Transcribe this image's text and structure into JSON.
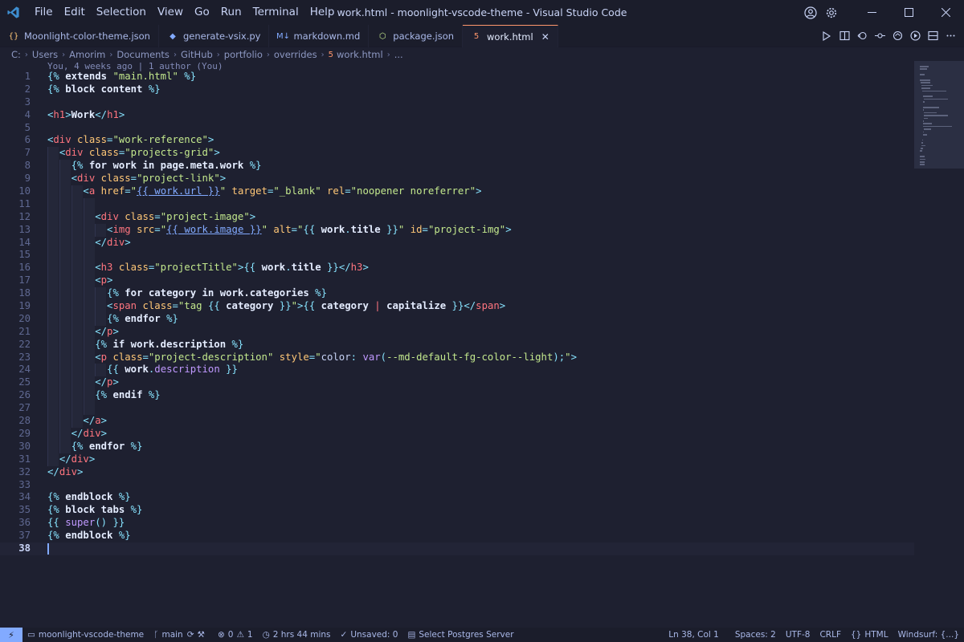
{
  "window": {
    "title": "work.html - moonlight-vscode-theme - Visual Studio Code",
    "menu": [
      "File",
      "Edit",
      "Selection",
      "View",
      "Go",
      "Run",
      "Terminal",
      "Help"
    ]
  },
  "tabs": [
    {
      "label": "Moonlight-color-theme.json",
      "icon": "json-icon",
      "glyph": "{}",
      "color": "#ffc777",
      "active": false
    },
    {
      "label": "generate-vsix.py",
      "icon": "python-icon",
      "glyph": "◆",
      "color": "#82aaff",
      "active": false
    },
    {
      "label": "markdown.md",
      "icon": "markdown-icon",
      "glyph": "M↓",
      "color": "#82aaff",
      "active": false
    },
    {
      "label": "package.json",
      "icon": "nodejs-icon",
      "glyph": "⬡",
      "color": "#c3e88d",
      "active": false
    },
    {
      "label": "work.html",
      "icon": "html-icon",
      "glyph": "5",
      "color": "#ff966c",
      "active": true
    }
  ],
  "breadcrumb": [
    "C:",
    "Users",
    "Amorim",
    "Documents",
    "GitHub",
    "portfolio",
    "overrides",
    "work.html",
    "..."
  ],
  "blame": "You, 4 weeks ago | 1 author (You)",
  "current_line": 38,
  "code_lines": [
    {
      "n": 1,
      "indent": 0,
      "tokens": [
        [
          "punct",
          "{%"
        ],
        [
          "text",
          " extends "
        ],
        [
          "str",
          "\"main.html\""
        ],
        [
          "punct",
          " %}"
        ]
      ]
    },
    {
      "n": 2,
      "indent": 0,
      "tokens": [
        [
          "punct",
          "{%"
        ],
        [
          "text",
          " block content "
        ],
        [
          "punct",
          "%}"
        ]
      ]
    },
    {
      "n": 3,
      "indent": 0,
      "tokens": []
    },
    {
      "n": 4,
      "indent": 0,
      "tokens": [
        [
          "punct",
          "<"
        ],
        [
          "tag",
          "h1"
        ],
        [
          "punct",
          ">"
        ],
        [
          "text",
          "Work"
        ],
        [
          "punct",
          "</"
        ],
        [
          "tag",
          "h1"
        ],
        [
          "punct",
          ">"
        ]
      ]
    },
    {
      "n": 5,
      "indent": 0,
      "tokens": []
    },
    {
      "n": 6,
      "indent": 0,
      "tokens": [
        [
          "punct",
          "<"
        ],
        [
          "tag",
          "div"
        ],
        [
          "attr",
          " class"
        ],
        [
          "punct",
          "="
        ],
        [
          "str",
          "\"work-reference\""
        ],
        [
          "punct",
          ">"
        ]
      ]
    },
    {
      "n": 7,
      "indent": 1,
      "tokens": [
        [
          "plain",
          "  "
        ],
        [
          "punct",
          "<"
        ],
        [
          "tag",
          "div"
        ],
        [
          "attr",
          " class"
        ],
        [
          "punct",
          "="
        ],
        [
          "str",
          "\"projects-grid\""
        ],
        [
          "punct",
          ">"
        ]
      ]
    },
    {
      "n": 8,
      "indent": 2,
      "tokens": [
        [
          "plain",
          "    "
        ],
        [
          "punct",
          "{%"
        ],
        [
          "text",
          " for work in page.meta.work "
        ],
        [
          "punct",
          "%}"
        ]
      ]
    },
    {
      "n": 9,
      "indent": 2,
      "tokens": [
        [
          "plain",
          "    "
        ],
        [
          "punct",
          "<"
        ],
        [
          "tag",
          "div"
        ],
        [
          "attr",
          " class"
        ],
        [
          "punct",
          "="
        ],
        [
          "str",
          "\"project-link\""
        ],
        [
          "punct",
          ">"
        ]
      ]
    },
    {
      "n": 10,
      "indent": 3,
      "tokens": [
        [
          "plain",
          "      "
        ],
        [
          "punct",
          "<"
        ],
        [
          "tag",
          "a"
        ],
        [
          "attr",
          " href"
        ],
        [
          "punct",
          "="
        ],
        [
          "str",
          "\""
        ],
        [
          "link",
          "{{ work.url }}"
        ],
        [
          "str",
          "\""
        ],
        [
          "attr",
          " target"
        ],
        [
          "punct",
          "="
        ],
        [
          "str",
          "\"_blank\""
        ],
        [
          "attr",
          " rel"
        ],
        [
          "punct",
          "="
        ],
        [
          "str",
          "\"noopener noreferrer\""
        ],
        [
          "punct",
          ">"
        ]
      ]
    },
    {
      "n": 11,
      "indent": 4,
      "tokens": []
    },
    {
      "n": 12,
      "indent": 4,
      "tokens": [
        [
          "plain",
          "        "
        ],
        [
          "punct",
          "<"
        ],
        [
          "tag",
          "div"
        ],
        [
          "attr",
          " class"
        ],
        [
          "punct",
          "="
        ],
        [
          "str",
          "\"project-image\""
        ],
        [
          "punct",
          ">"
        ]
      ]
    },
    {
      "n": 13,
      "indent": 5,
      "tokens": [
        [
          "plain",
          "          "
        ],
        [
          "punct",
          "<"
        ],
        [
          "tag",
          "img"
        ],
        [
          "attr",
          " src"
        ],
        [
          "punct",
          "="
        ],
        [
          "str",
          "\""
        ],
        [
          "link",
          "{{ work.image }}"
        ],
        [
          "str",
          "\""
        ],
        [
          "attr",
          " alt"
        ],
        [
          "punct",
          "="
        ],
        [
          "str",
          "\""
        ],
        [
          "punct",
          "{{ "
        ],
        [
          "var",
          "work"
        ],
        [
          "punct",
          "."
        ],
        [
          "var",
          "title"
        ],
        [
          "punct",
          " }}"
        ],
        [
          "str",
          "\""
        ],
        [
          "attr",
          " id"
        ],
        [
          "punct",
          "="
        ],
        [
          "str",
          "\"project-img\""
        ],
        [
          "punct",
          ">"
        ]
      ]
    },
    {
      "n": 14,
      "indent": 4,
      "tokens": [
        [
          "plain",
          "        "
        ],
        [
          "punct",
          "</"
        ],
        [
          "tag",
          "div"
        ],
        [
          "punct",
          ">"
        ]
      ]
    },
    {
      "n": 15,
      "indent": 4,
      "tokens": []
    },
    {
      "n": 16,
      "indent": 4,
      "tokens": [
        [
          "plain",
          "        "
        ],
        [
          "punct",
          "<"
        ],
        [
          "tag",
          "h3"
        ],
        [
          "attr",
          " class"
        ],
        [
          "punct",
          "="
        ],
        [
          "str",
          "\"projectTitle\""
        ],
        [
          "punct",
          ">"
        ],
        [
          "punct",
          "{{ "
        ],
        [
          "var",
          "work"
        ],
        [
          "punct",
          "."
        ],
        [
          "var",
          "title"
        ],
        [
          "punct",
          " }}"
        ],
        [
          "punct",
          "</"
        ],
        [
          "tag",
          "h3"
        ],
        [
          "punct",
          ">"
        ]
      ]
    },
    {
      "n": 17,
      "indent": 4,
      "tokens": [
        [
          "plain",
          "        "
        ],
        [
          "punct",
          "<"
        ],
        [
          "tag",
          "p"
        ],
        [
          "punct",
          ">"
        ]
      ]
    },
    {
      "n": 18,
      "indent": 5,
      "tokens": [
        [
          "plain",
          "          "
        ],
        [
          "punct",
          "{%"
        ],
        [
          "text",
          " for category in work.categories "
        ],
        [
          "punct",
          "%}"
        ]
      ]
    },
    {
      "n": 19,
      "indent": 5,
      "tokens": [
        [
          "plain",
          "          "
        ],
        [
          "punct",
          "<"
        ],
        [
          "tag",
          "span"
        ],
        [
          "attr",
          " class"
        ],
        [
          "punct",
          "="
        ],
        [
          "str",
          "\"tag "
        ],
        [
          "punct",
          "{{ "
        ],
        [
          "var",
          "category"
        ],
        [
          "punct",
          " }}"
        ],
        [
          "str",
          "\""
        ],
        [
          "punct",
          ">"
        ],
        [
          "punct",
          "{{ "
        ],
        [
          "var",
          "category"
        ],
        [
          "pipe",
          " | "
        ],
        [
          "var",
          "capitalize"
        ],
        [
          "punct",
          " }}"
        ],
        [
          "punct",
          "</"
        ],
        [
          "tag",
          "span"
        ],
        [
          "punct",
          ">"
        ]
      ]
    },
    {
      "n": 20,
      "indent": 5,
      "tokens": [
        [
          "plain",
          "          "
        ],
        [
          "punct",
          "{%"
        ],
        [
          "text",
          " endfor "
        ],
        [
          "punct",
          "%}"
        ]
      ]
    },
    {
      "n": 21,
      "indent": 4,
      "tokens": [
        [
          "plain",
          "        "
        ],
        [
          "punct",
          "</"
        ],
        [
          "tag",
          "p"
        ],
        [
          "punct",
          ">"
        ]
      ]
    },
    {
      "n": 22,
      "indent": 4,
      "tokens": [
        [
          "plain",
          "        "
        ],
        [
          "punct",
          "{%"
        ],
        [
          "text",
          " if work.description "
        ],
        [
          "punct",
          "%}"
        ]
      ]
    },
    {
      "n": 23,
      "indent": 4,
      "tokens": [
        [
          "plain",
          "        "
        ],
        [
          "punct",
          "<"
        ],
        [
          "tag",
          "p"
        ],
        [
          "attr",
          " class"
        ],
        [
          "punct",
          "="
        ],
        [
          "str",
          "\"project-description\""
        ],
        [
          "attr",
          " style"
        ],
        [
          "punct",
          "="
        ],
        [
          "str",
          "\""
        ],
        [
          "plain",
          "color"
        ],
        [
          "punct",
          ": "
        ],
        [
          "kw",
          "var"
        ],
        [
          "punct",
          "("
        ],
        [
          "str",
          "--md-default-fg-color--light"
        ],
        [
          "punct",
          ");"
        ],
        [
          "str",
          "\""
        ],
        [
          "punct",
          ">"
        ]
      ]
    },
    {
      "n": 24,
      "indent": 5,
      "tokens": [
        [
          "plain",
          "          "
        ],
        [
          "punct",
          "{{ "
        ],
        [
          "var",
          "work"
        ],
        [
          "punct",
          "."
        ],
        [
          "kw",
          "description"
        ],
        [
          "punct",
          " }}"
        ]
      ]
    },
    {
      "n": 25,
      "indent": 4,
      "tokens": [
        [
          "plain",
          "        "
        ],
        [
          "punct",
          "</"
        ],
        [
          "tag",
          "p"
        ],
        [
          "punct",
          ">"
        ]
      ]
    },
    {
      "n": 26,
      "indent": 4,
      "tokens": [
        [
          "plain",
          "        "
        ],
        [
          "punct",
          "{%"
        ],
        [
          "text",
          " endif "
        ],
        [
          "punct",
          "%}"
        ]
      ]
    },
    {
      "n": 27,
      "indent": 4,
      "tokens": []
    },
    {
      "n": 28,
      "indent": 3,
      "tokens": [
        [
          "plain",
          "      "
        ],
        [
          "punct",
          "</"
        ],
        [
          "tag",
          "a"
        ],
        [
          "punct",
          ">"
        ]
      ]
    },
    {
      "n": 29,
      "indent": 2,
      "tokens": [
        [
          "plain",
          "    "
        ],
        [
          "punct",
          "</"
        ],
        [
          "tag",
          "div"
        ],
        [
          "punct",
          ">"
        ]
      ]
    },
    {
      "n": 30,
      "indent": 2,
      "tokens": [
        [
          "plain",
          "    "
        ],
        [
          "punct",
          "{%"
        ],
        [
          "text",
          " endfor "
        ],
        [
          "punct",
          "%}"
        ]
      ]
    },
    {
      "n": 31,
      "indent": 1,
      "tokens": [
        [
          "plain",
          "  "
        ],
        [
          "punct",
          "</"
        ],
        [
          "tag",
          "div"
        ],
        [
          "punct",
          ">"
        ]
      ]
    },
    {
      "n": 32,
      "indent": 0,
      "tokens": [
        [
          "punct",
          "</"
        ],
        [
          "tag",
          "div"
        ],
        [
          "punct",
          ">"
        ]
      ]
    },
    {
      "n": 33,
      "indent": 0,
      "tokens": []
    },
    {
      "n": 34,
      "indent": 0,
      "tokens": [
        [
          "punct",
          "{%"
        ],
        [
          "text",
          " endblock "
        ],
        [
          "punct",
          "%}"
        ]
      ]
    },
    {
      "n": 35,
      "indent": 0,
      "tokens": [
        [
          "punct",
          "{%"
        ],
        [
          "text",
          " block tabs "
        ],
        [
          "punct",
          "%}"
        ]
      ]
    },
    {
      "n": 36,
      "indent": 0,
      "tokens": [
        [
          "punct",
          "{{ "
        ],
        [
          "kw",
          "super"
        ],
        [
          "punct",
          "() }}"
        ]
      ]
    },
    {
      "n": 37,
      "indent": 0,
      "tokens": [
        [
          "punct",
          "{%"
        ],
        [
          "text",
          " endblock "
        ],
        [
          "punct",
          "%}"
        ]
      ]
    },
    {
      "n": 38,
      "indent": 0,
      "tokens": []
    }
  ],
  "status": {
    "repo": "moonlight-vscode-theme",
    "branch": "main",
    "errors": "0",
    "warnings": "1",
    "time": "2 hrs 44 mins",
    "unsaved": "Unsaved: 0",
    "postgres": "Select Postgres Server",
    "position": "Ln 38, Col 1",
    "spaces": "Spaces: 2",
    "encoding": "UTF-8",
    "eol": "CRLF",
    "language": "HTML",
    "windsurf": "Windsurf: {...}"
  },
  "colors": {
    "background": "#1e2030",
    "chrome": "#1b1d2b",
    "accent": "#82aaff",
    "active_tab_border": "#ff966c"
  }
}
